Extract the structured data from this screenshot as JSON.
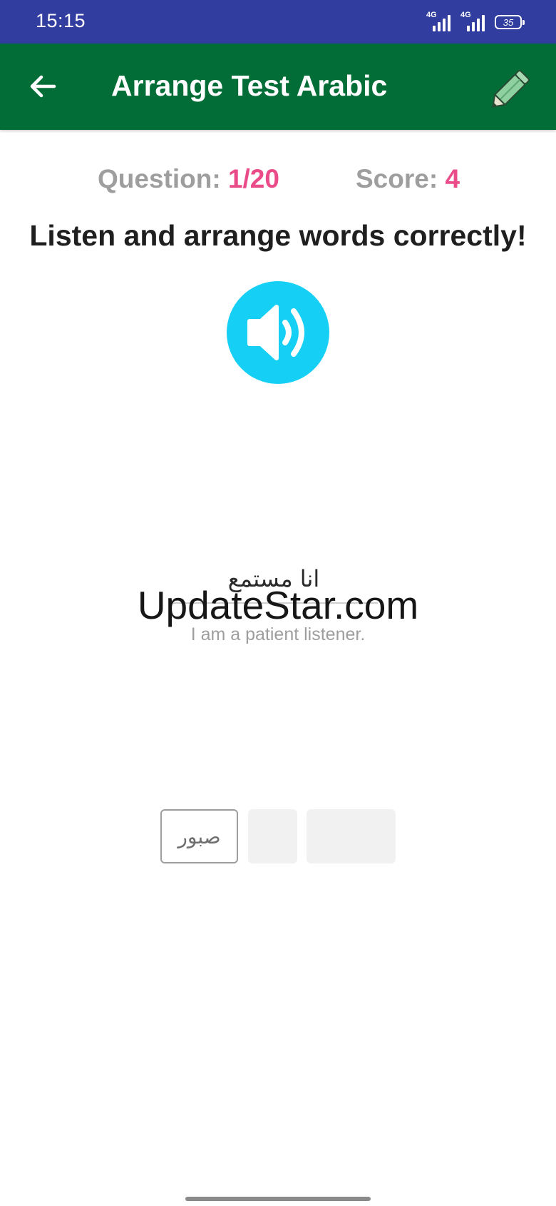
{
  "status_bar": {
    "time": "15:15",
    "network_1": "4G",
    "network_2": "4G",
    "battery": "35",
    "background": "#313e9f"
  },
  "app_bar": {
    "title": "Arrange Test Arabic",
    "back_icon": "arrow-back-icon",
    "action_icon": "pencil-icon",
    "background": "#026d36"
  },
  "stats": {
    "question_label": "Question: ",
    "question_value": "1/20",
    "score_label": "Score: ",
    "score_value": "4",
    "accent": "#ea4c89"
  },
  "instruction": "Listen and arrange words correctly!",
  "speaker": {
    "icon": "speaker-volume-icon",
    "color": "#15cff5"
  },
  "answer": {
    "arranged_text": "انا مستمع",
    "translation": "I am a patient listener."
  },
  "watermark": "UpdateStar.com",
  "word_chips": [
    {
      "label": "صبور",
      "state": "available"
    },
    {
      "label": "",
      "state": "used"
    },
    {
      "label": "",
      "state": "used"
    }
  ]
}
